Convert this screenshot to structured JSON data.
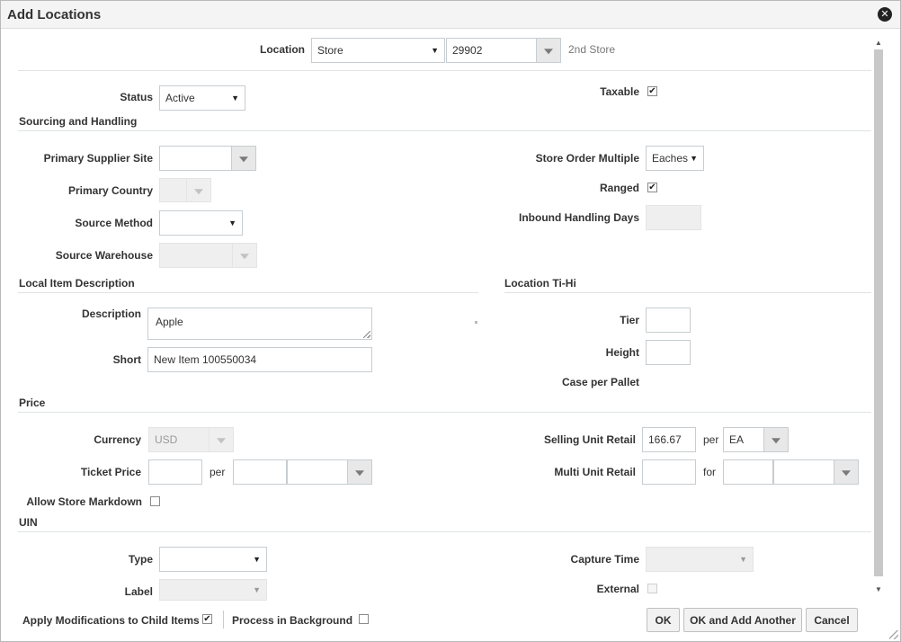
{
  "dialog": {
    "title": "Add Locations"
  },
  "location": {
    "label": "Location",
    "type_value": "Store",
    "id_value": "29902",
    "name": "2nd Store"
  },
  "status": {
    "label": "Status",
    "value": "Active"
  },
  "taxable": {
    "label": "Taxable",
    "checked": true
  },
  "sourcing": {
    "title": "Sourcing and Handling",
    "primary_supplier_site": "Primary Supplier Site",
    "primary_country": "Primary Country",
    "source_method": "Source Method",
    "source_warehouse": "Source Warehouse",
    "store_order_multiple": {
      "label": "Store Order Multiple",
      "value": "Eaches"
    },
    "ranged": {
      "label": "Ranged",
      "checked": true
    },
    "inbound_handling_days": "Inbound Handling Days"
  },
  "local_item": {
    "title": "Local Item Description",
    "description": {
      "label": "Description",
      "value": "Apple"
    },
    "short": {
      "label": "Short",
      "value": "New Item 100550034"
    }
  },
  "tihi": {
    "title": "Location Ti-Hi",
    "tier": "Tier",
    "height": "Height",
    "case_per_pallet": "Case per Pallet"
  },
  "price": {
    "title": "Price",
    "currency": {
      "label": "Currency",
      "value": "USD"
    },
    "ticket_price": {
      "label": "Ticket Price",
      "per": "per"
    },
    "allow_store_markdown": "Allow Store Markdown",
    "selling_unit_retail": {
      "label": "Selling Unit Retail",
      "value": "166.67",
      "per": "per",
      "uom": "EA"
    },
    "multi_unit_retail": {
      "label": "Multi Unit Retail",
      "for": "for"
    }
  },
  "uin": {
    "title": "UIN",
    "type": "Type",
    "label": "Label",
    "capture_time": "Capture Time",
    "external": "External"
  },
  "footer": {
    "apply_child": {
      "label": "Apply Modifications to Child Items",
      "checked": true
    },
    "process_bg": {
      "label": "Process in Background",
      "checked": false
    },
    "ok": "OK",
    "ok_add_another": "OK and Add Another",
    "cancel": "Cancel"
  },
  "check_mark": "✔",
  "close_glyph": "✕"
}
